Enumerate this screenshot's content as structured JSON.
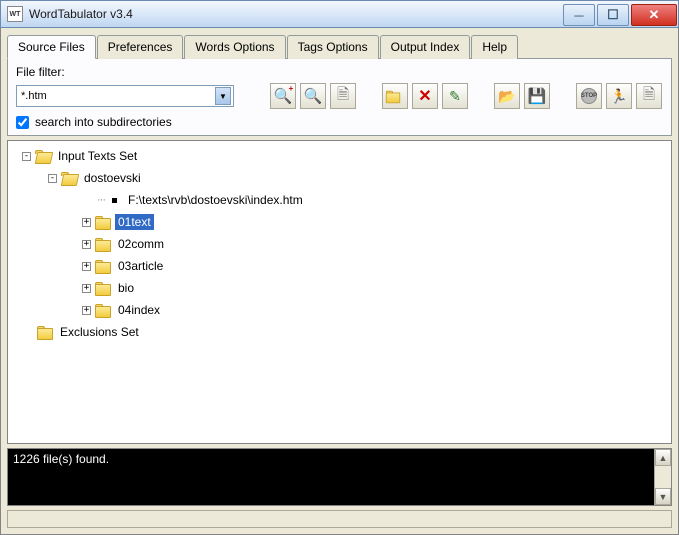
{
  "window": {
    "title": "WordTabulator v3.4"
  },
  "tabs": [
    {
      "label": "Source Files",
      "active": true
    },
    {
      "label": "Preferences",
      "active": false
    },
    {
      "label": "Words Options",
      "active": false
    },
    {
      "label": "Tags Options",
      "active": false
    },
    {
      "label": "Output Index",
      "active": false
    },
    {
      "label": "Help",
      "active": false
    }
  ],
  "filter": {
    "caption": "File filter:",
    "value": "*.htm",
    "subdirs_label": "search into subdirectories",
    "subdirs_checked": true
  },
  "toolbar": {
    "add_file": "add-file",
    "search_file": "search-file",
    "search_doc": "search-doc",
    "new_folder": "new-folder",
    "delete_item": "delete-item",
    "clear": "clear",
    "open": "open",
    "save": "save",
    "stop": "stop",
    "go": "go",
    "export": "export"
  },
  "tree": {
    "root1": {
      "label": "Input Texts Set",
      "expanded": true
    },
    "child1": {
      "label": "dostoevski",
      "expanded": true
    },
    "file1": {
      "label": "F:\\texts\\rvb\\dostoevski\\index.htm"
    },
    "folders": [
      {
        "label": "01text",
        "selected": true
      },
      {
        "label": "02comm",
        "selected": false
      },
      {
        "label": "03article",
        "selected": false
      },
      {
        "label": "bio",
        "selected": false
      },
      {
        "label": "04index",
        "selected": false
      }
    ],
    "root2": {
      "label": "Exclusions Set",
      "expanded": false
    }
  },
  "status": {
    "message": "1226 file(s) found."
  }
}
